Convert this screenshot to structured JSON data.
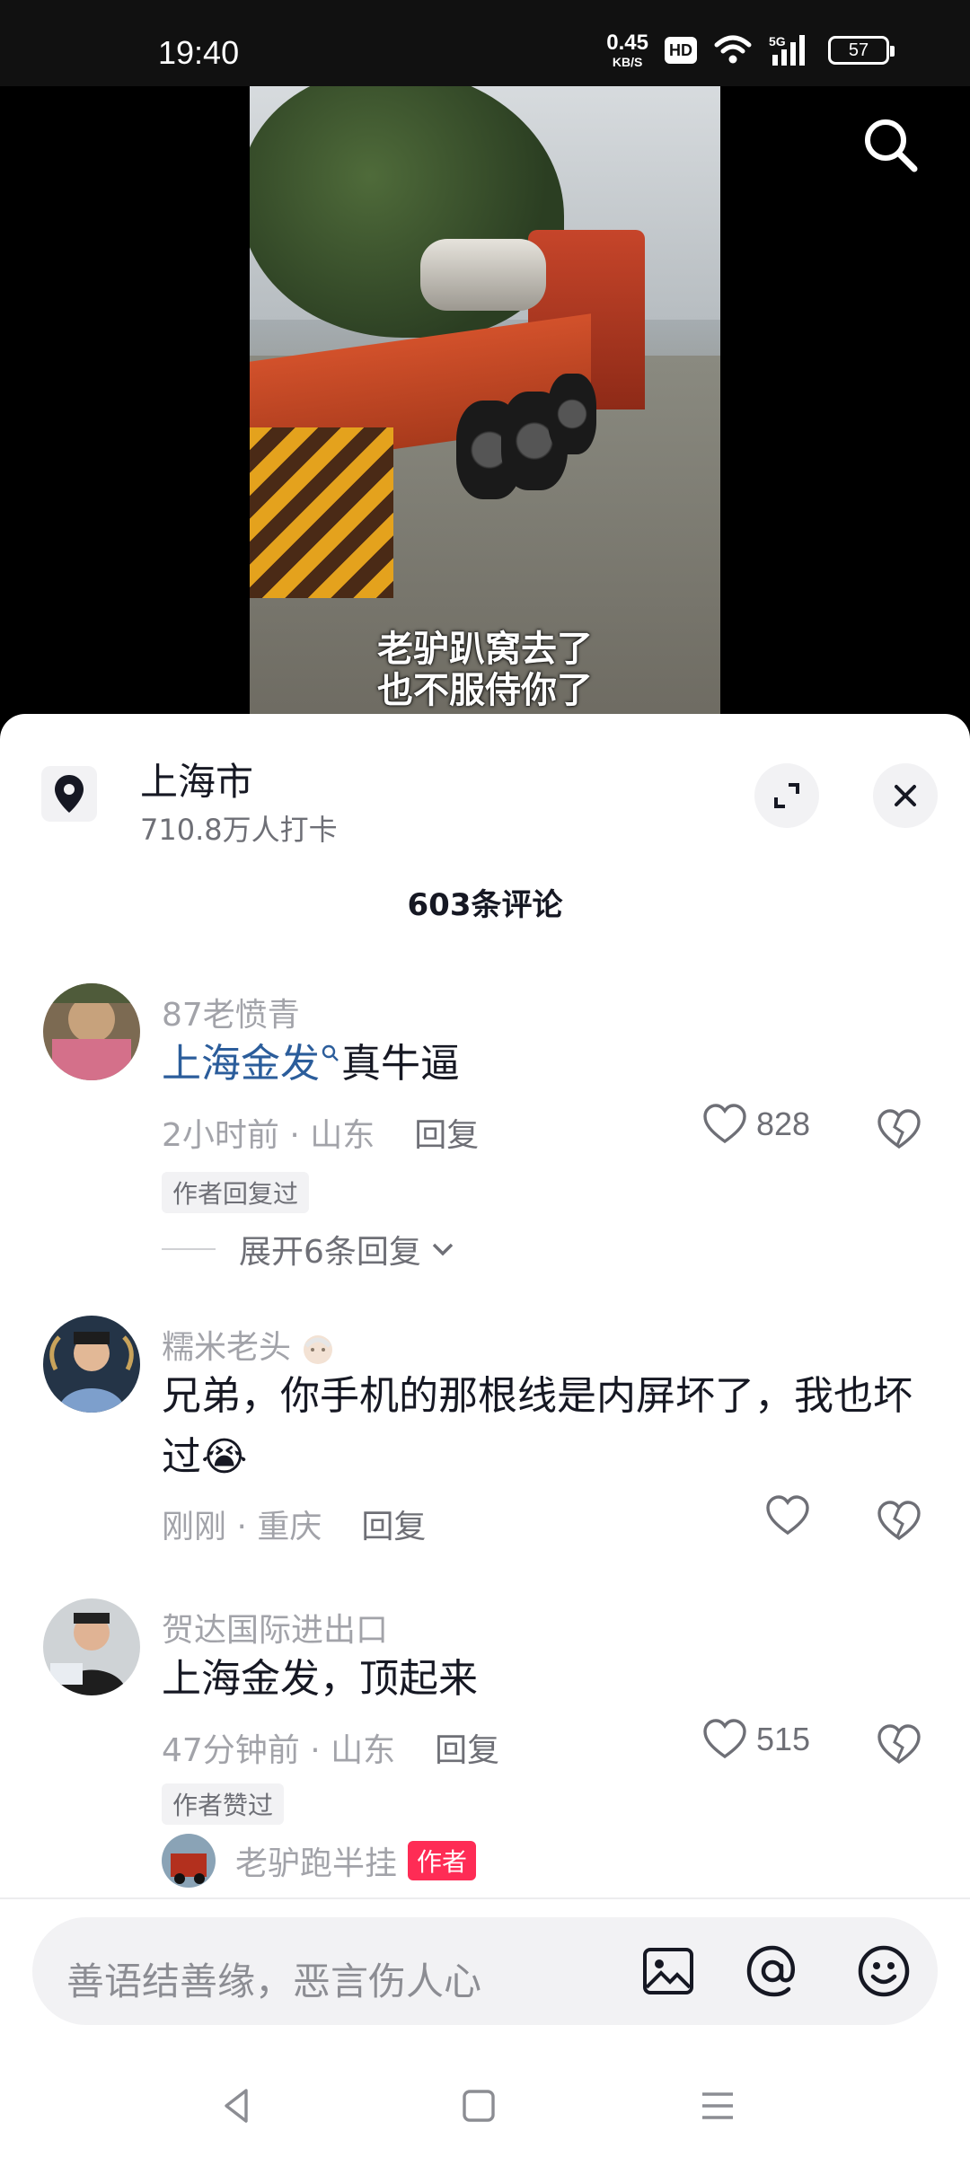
{
  "status_bar": {
    "time": "19:40",
    "net_speed": "0.45",
    "net_unit": "KB/S",
    "hd_label": "HD",
    "battery": "57"
  },
  "video": {
    "subtitle_line1": "老驴趴窝去了",
    "subtitle_line2": "也不服侍你了",
    "search_icon": "search-icon"
  },
  "location": {
    "title": "上海市",
    "checkins": "710.8万人打卡"
  },
  "comments_header": "603条评论",
  "comments": [
    {
      "user": "87老愤青",
      "tag_text": "上海金发",
      "text": "真牛逼",
      "time_loc": "2小时前 · 山东",
      "reply": "回复",
      "likes": "828",
      "badge": "作者回复过",
      "expand": "展开6条回复"
    },
    {
      "user": "糯米老头",
      "text": "兄弟，你手机的那根线是内屏坏了，我也坏过",
      "emoji": "😭",
      "time_loc": "刚刚 · 重庆",
      "reply": "回复",
      "likes": ""
    },
    {
      "user": "贺达国际进出口",
      "text": "上海金发，顶起来",
      "time_loc": "47分钟前 · 山东",
      "reply": "回复",
      "likes": "515",
      "badge": "作者赞过",
      "reply_user": "老驴跑半挂",
      "reply_user_tag": "作者"
    }
  ],
  "input": {
    "placeholder": "善语结善缘，恶言伤人心"
  },
  "colors": {
    "accent_red": "#fe2c55",
    "link_blue": "#2b5d9b"
  }
}
